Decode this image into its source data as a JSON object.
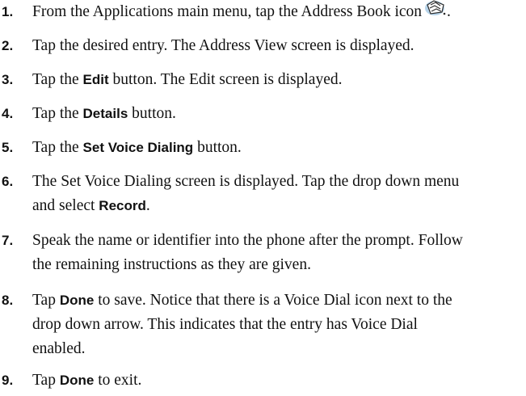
{
  "steps": [
    {
      "num": "1.",
      "line1_text": "From the Applications main menu, tap the Address Book icon",
      "line1_after": ".",
      "icon": "address-book-icon"
    },
    {
      "num": "2.",
      "text": "Tap the desired entry. The Address View screen is displayed."
    },
    {
      "num": "3.",
      "before": "Tap the ",
      "bold": "Edit",
      "after": " button. The Edit screen is displayed."
    },
    {
      "num": "4.",
      "before": "Tap the ",
      "bold": "Details",
      "after": " button."
    },
    {
      "num": "5.",
      "before": "Tap the ",
      "bold": "Set Voice Dialing",
      "after": " button."
    },
    {
      "num": "6.",
      "line1": "The Set Voice Dialing screen is displayed. Tap the drop down menu",
      "line2_before": "and select ",
      "line2_bold": "Record",
      "line2_after": "."
    },
    {
      "num": "7.",
      "line1": "Speak the name or identifier into the phone after the prompt. Follow",
      "line2": "the remaining instructions as they are given."
    },
    {
      "num": "8.",
      "line1_before": "Tap ",
      "line1_bold": "Done",
      "line1_after": " to save. Notice that there is a Voice Dial icon next to the",
      "line2": "drop down arrow. This indicates that the entry has Voice Dial",
      "line3": "enabled."
    },
    {
      "num": "9.",
      "before": "Tap ",
      "bold": "Done",
      "after": " to exit."
    }
  ]
}
